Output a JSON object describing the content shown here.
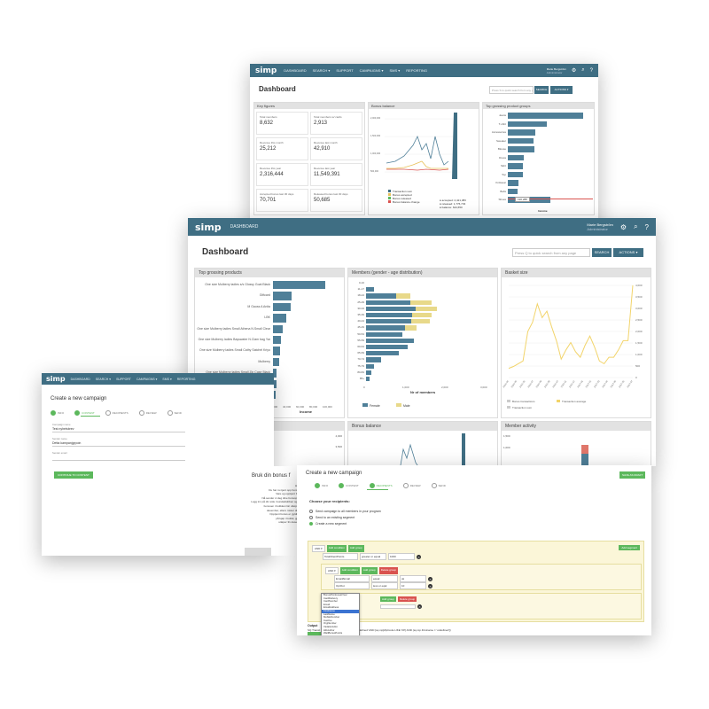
{
  "colors": {
    "nav": "#3f6e83",
    "bar": "#4f7f98",
    "female": "#4f7f98",
    "male": "#e8d98a",
    "green": "#5cb85c",
    "red": "#d9534f",
    "line": "#f2d46a"
  },
  "win1": {
    "nav": {
      "logo": "simp",
      "items": [
        "DASHBOARD",
        "SEARCH ▾",
        "SUPPORT",
        "CAMPAIGNS ▾",
        "SMS ▾",
        "REPORTING"
      ],
      "user": "Marie Bergström",
      "user_sub": "Administrator"
    },
    "title": "Dashboard",
    "search_placeholder": "Press S to quick search from any page",
    "search_btn": "SEARCH",
    "actions_btn": "ACTIONS ▾",
    "key_figures": {
      "title": "Key figures",
      "items": [
        {
          "label": "Total members",
          "value": "8,632"
        },
        {
          "label": "Total members w/ cards",
          "value": "2,913"
        },
        {
          "label": "Revenue this month",
          "value": "25,212"
        },
        {
          "label": "Revenue last month",
          "value": "42,910"
        },
        {
          "label": "Revenue this year",
          "value": "2,316,444"
        },
        {
          "label": "Revenue last year",
          "value": "11,549,391"
        },
        {
          "label": "Accepted bonus last 30 days",
          "value": "70,701"
        },
        {
          "label": "Released bonus last 30 days",
          "value": "50,685"
        }
      ]
    },
    "bonus_balance": {
      "title": "Bonus balance",
      "legend": [
        "Transaction sum",
        "Bonus accepted",
        "Bonus released",
        "Bonus balance change"
      ],
      "stats": [
        "● accepted: 2,421,383",
        "● released: 1,776,733",
        "● balance: 644,650"
      ]
    },
    "top_groups": {
      "title": "Top grossing product groups",
      "xlabel": "Income",
      "categories": [
        "Jeans",
        "T-shirt",
        "Accessories",
        "Sweater",
        "Blouse",
        "Dress",
        "Skirt",
        "Top",
        "Knitwear",
        "Belts",
        "Shoes"
      ],
      "values": [
        92,
        48,
        34,
        31,
        33,
        20,
        19,
        18,
        13,
        12,
        52
      ],
      "highlight": "190,288"
    },
    "top_products": {
      "title": "Top grossing products",
      "rows": [
        "One size Mulberry ladies s/s Glossy Goat Black",
        "Giftcard",
        "M Gauss A Anita"
      ]
    },
    "members_dist": {
      "title": "Members (gender - age distribution)"
    },
    "key_figures_2": {
      "title": "Key figures",
      "items": [
        {
          "label": "Total members",
          "value": "8,632"
        },
        {
          "label": "Total members w/ cards",
          "value": "2,913"
        }
      ]
    }
  },
  "win2": {
    "nav": {
      "logo": "simp",
      "items": [
        "DASHBOARD"
      ],
      "user": "Marie Bergström",
      "user_sub": "Administrator"
    },
    "title": "Dashboard",
    "search_placeholder": "Press Q to quick search from any page",
    "search_btn": "SEARCH",
    "actions_btn": "ACTIONS ▾",
    "top_products": {
      "title": "Top grossing products",
      "xlabel": "Income",
      "ticks": [
        "20,000",
        "40,000",
        "60,000",
        "80,000",
        "100,000"
      ],
      "rows": [
        "One size Mulberry ladies s/s Glossy Goat Black",
        "Giftcard",
        "M Gauss A Anita",
        "LBK",
        "One size Mulberry ladies Small Athena N.Small Clear",
        "One size Mulberry ladies Bayswater N.Clam bag Yar",
        "One size Mulberry ladies Small Cathy Satchel Kriyo",
        "Mulberry",
        "One size Mulberry ladies Small Zip Case Black",
        "One size Mulberry ladies Small Seaton Small Glossy",
        "SE Sopra Breva 502665 T"
      ],
      "values": [
        100,
        36,
        33,
        25,
        18,
        15,
        13,
        11,
        7,
        6,
        5
      ]
    },
    "members": {
      "title": "Members (gender - age distribution)",
      "xlabel": "Nr of members",
      "legend": [
        "Female",
        "Male"
      ],
      "ticks": [
        "0",
        "1,000",
        "2,000",
        "3,000"
      ],
      "ages": [
        "0-10",
        "11-17",
        "18-24",
        "25-29",
        "30-34",
        "35-39",
        "40-44",
        "45-49",
        "50-54",
        "55-59",
        "60-64",
        "65-69",
        "70-74",
        "75-79",
        "80-84",
        "85+"
      ],
      "female": [
        0,
        10,
        38,
        56,
        62,
        58,
        57,
        49,
        46,
        60,
        52,
        41,
        19,
        10,
        7,
        4
      ],
      "male": [
        0,
        0,
        55,
        80,
        82,
        75,
        72,
        46,
        0,
        0,
        0,
        0,
        0,
        0,
        0,
        0
      ]
    },
    "basket": {
      "title": "Basket size",
      "yticks": [
        "4,000",
        "3,500",
        "3,000",
        "2,500",
        "2,000",
        "1,500",
        "1,000",
        "500",
        "0"
      ],
      "legend": [
        "Bonus transactions",
        "Transaction sum",
        "Transaction average"
      ],
      "points": [
        10,
        12,
        15,
        18,
        50,
        60,
        80,
        65,
        72,
        55,
        40,
        20,
        30,
        38,
        28,
        22,
        35,
        45,
        33,
        18,
        15,
        22,
        22,
        30,
        40,
        40,
        100
      ],
      "xlabels": [
        "2016-04",
        "2016-05",
        "2016-06",
        "2016-07",
        "2016-08",
        "2016-09",
        "2016-10",
        "2016-11",
        "2016-12",
        "2017-01",
        "2017-02",
        "2017-03",
        "2017-04",
        "2017-05",
        "2017-06",
        "2017-07"
      ]
    },
    "basket2": {
      "title": "Basket size",
      "ticks": [
        "4,000",
        "3,500"
      ]
    },
    "bonus2": {
      "title": "Bonus balance"
    },
    "activity": {
      "title": "Member activity",
      "ticks": [
        "1,500",
        "1,000"
      ]
    }
  },
  "win3": {
    "nav": {
      "logo": "simp",
      "items": [
        "DASHBOARD",
        "SEARCH ▾",
        "SUPPORT",
        "CAMPAIGNS ▾",
        "SMS ▾",
        "REPORTING"
      ]
    },
    "title": "Create a new campaign",
    "steps": [
      "INFO",
      "CONTENT",
      "RECIPIENTS",
      "REVIEW",
      "SEND"
    ],
    "fields": [
      {
        "label": "Campaign name",
        "value": "Test nyhetsbrev"
      },
      {
        "label": "Sender name",
        "value": "Detta kampanjgrpoin"
      },
      {
        "label": "Sender email",
        "value": ""
      }
    ],
    "continue_btn": "CONTINUE TO CONTENT",
    "bonus_title": "Bruk din bonus f",
    "bonus_lines": [
      "Hei Oli",
      "Du har nu tjent opp bonus på",
      "Vare og opptjent bonus",
      "Nå sender vi deg dine bonuspoeng",
      "Logg inn på din side i kundeklubben og bruk",
      "bonusen i butikken før utløpsdato",
      "desember, ellers mister du den",
      "Opptjent bonus er gyldig når",
      "på kjøp i butikk, gjelder",
      "utløper 31 desember"
    ]
  },
  "win4": {
    "title": "Create a new campaign",
    "save_draft": "SAVE AS DRAFT",
    "steps": [
      "INFO",
      "CONTENT",
      "RECIPIENTS",
      "REVIEW",
      "SEND"
    ],
    "choose": "Choose your recipients:",
    "options": [
      "Send campaign to all members in your program",
      "Send to an existing segment",
      "Create a new segment"
    ],
    "and_btn": "AND ▾",
    "add_condition": "Add condition",
    "add_group": "Add group",
    "delete_group": "Delete group",
    "add_segment": "Add segment",
    "rows": [
      {
        "field": "TotalClientPoints",
        "op": "greater or equal",
        "value": "1000"
      },
      {
        "field": "Email/Email",
        "op": "equal",
        "value": "ok"
      },
      {
        "field": "OptOut",
        "op": "less or eqal",
        "value": "10"
      }
    ],
    "dropdown": [
      "BonusPointsLastYear",
      "CardDelivery",
      "CardNumber",
      "Email",
      "EmailAddress",
      "FirstName",
      "LastName",
      "MobileNumber",
      "Inactive",
      "OrgNumber",
      "ViolationHist",
      "HibAuthor",
      "WaitBonusPoints",
      "PhoneNumber",
      "ProductDisplayTime"
    ],
    "output_label": "Output",
    "output_sql": "SQ Transit   [ext.Reg[DepartmentName = 'undefined' AND [sq.mp[ZipCode LIKE '00'] AND (sq.mp.Firstname = 'undefined'])"
  }
}
